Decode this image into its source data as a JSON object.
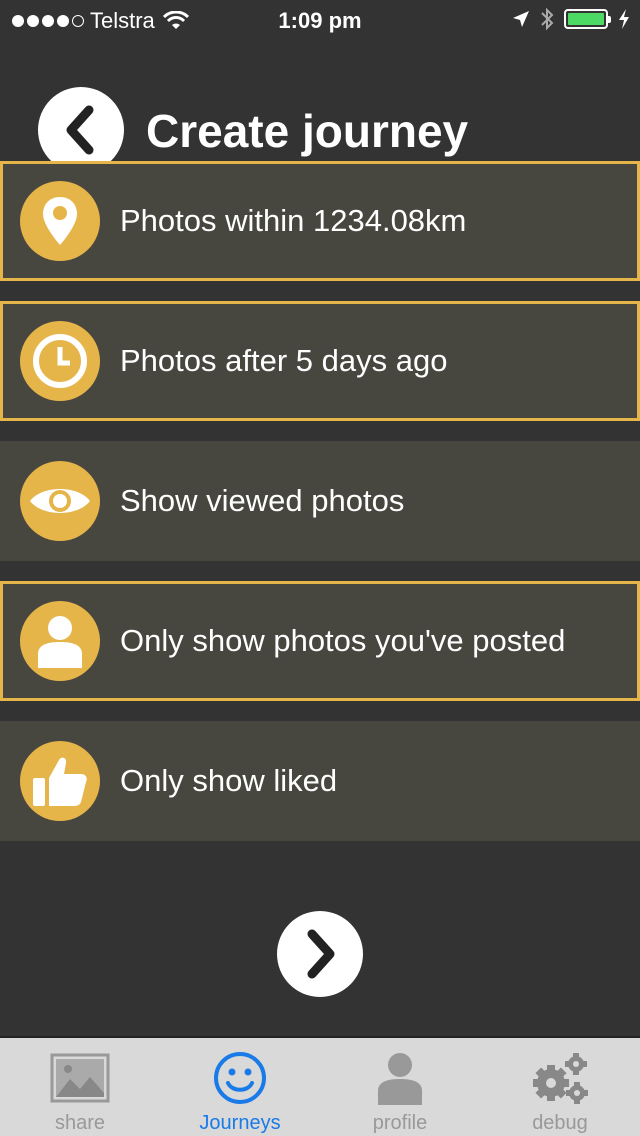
{
  "status_bar": {
    "carrier": "Telstra",
    "signal_bars_filled": 4,
    "signal_bars_total": 5,
    "time": "1:09 pm"
  },
  "header": {
    "title": "Create journey",
    "back_icon": "chevron-left-icon"
  },
  "options": [
    {
      "label": "Photos within 1234.08km",
      "icon": "location-pin-icon",
      "selected": true
    },
    {
      "label": "Photos after 5 days ago",
      "icon": "clock-icon",
      "selected": true
    },
    {
      "label": "Show viewed photos",
      "icon": "eye-icon",
      "selected": false
    },
    {
      "label": "Only show photos you've posted",
      "icon": "person-icon",
      "selected": true
    },
    {
      "label": "Only show liked",
      "icon": "thumbs-up-icon",
      "selected": false
    }
  ],
  "next_icon": "chevron-right-icon",
  "tabs": [
    {
      "label": "share",
      "icon": "image-icon",
      "active": false
    },
    {
      "label": "Journeys",
      "icon": "smiley-icon",
      "active": true
    },
    {
      "label": "profile",
      "icon": "person-icon",
      "active": false
    },
    {
      "label": "debug",
      "icon": "gears-icon",
      "active": false
    }
  ],
  "colors": {
    "background": "#333333",
    "option_background": "#474740",
    "accent": "#e6b54a",
    "tab_active": "#1a7ae8",
    "tab_inactive": "#999999",
    "battery": "#4cd964"
  }
}
